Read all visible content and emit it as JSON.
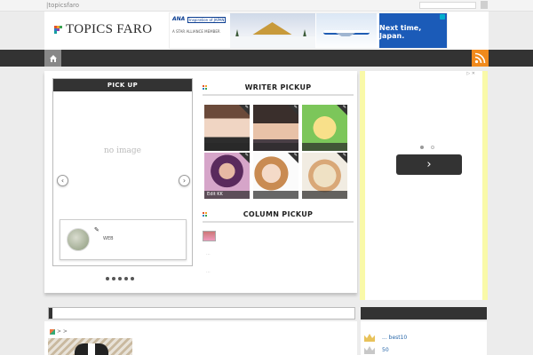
{
  "topbar": {
    "tagline": "|topicsfaro"
  },
  "header": {
    "logo_text": "TOPICS FARO",
    "ad": {
      "brand": "ANA",
      "tagline": "Inspiration of JAPAN",
      "alliance": "A STAR ALLIANCE MEMBER",
      "cta": "Next time, Japan."
    }
  },
  "nav": {
    "home_icon": "home-icon",
    "rss_icon": "rss-icon"
  },
  "pickup": {
    "title": "PICK UP",
    "placeholder": "no image",
    "prev": "‹",
    "next": "›",
    "card": {
      "pen": "✎",
      "category": "WEB"
    },
    "slide_count": 5
  },
  "writer_pickup": {
    "title": "WRITER PICKUP",
    "writers": [
      {
        "label": ""
      },
      {
        "label": ""
      },
      {
        "label": ""
      },
      {
        "label": "Edit KK"
      },
      {
        "label": ""
      },
      {
        "label": ""
      }
    ]
  },
  "column_pickup": {
    "title": "COLUMN PICKUP",
    "items": [
      "...",
      "..."
    ]
  },
  "side_ad": {
    "choice": "▷ ✕",
    "next_label": "›"
  },
  "post": {
    "breadcrumb": "> >"
  },
  "ranking": [
    {
      "label": "... best10",
      "color": "#e8c25a"
    },
    {
      "label": "50",
      "color": "#c8c8c8"
    }
  ],
  "colors": {
    "accent": "#f18a1c",
    "nav": "#333333",
    "ad_blue": "#1b5bb8",
    "side_ad_frame": "#f9f9a8"
  }
}
